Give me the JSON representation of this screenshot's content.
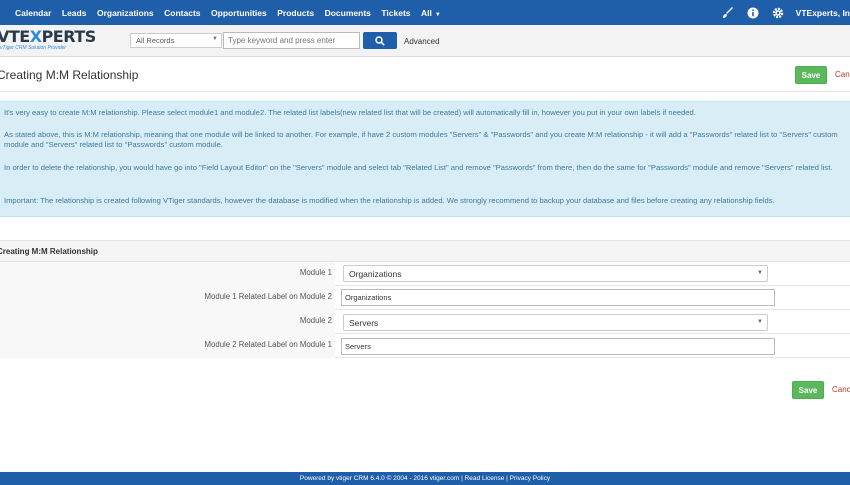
{
  "nav": {
    "items": [
      "Calendar",
      "Leads",
      "Organizations",
      "Contacts",
      "Opportunities",
      "Products",
      "Documents",
      "Tickets",
      "All"
    ],
    "user": "VTExperts, In"
  },
  "search": {
    "records_select": "All Records",
    "keyword_placeholder": "Type keyword and press enter",
    "advanced_label": "Advanced"
  },
  "logo": {
    "brand_a": "VTE",
    "brand_b": "X",
    "brand_c": "PERTS",
    "tagline": "vTiger CRM Solution Provider"
  },
  "page": {
    "title": "Creating M:M Relationship",
    "save_label": "Save",
    "cancel_label": "Cancel"
  },
  "info": {
    "p1": "It's very easy to create M:M relationship. Please select module1 and module2. The related list labels(new related list that will be created) will automatically fill in, however you put in your own labels if needed.",
    "p2": "As stated above, this is M:M relationship, meaning that one module will be linked to another. For example, if have 2 custom modules \"Servers\" & \"Passwords\" and you create M:M relationship - it will add a \"Passwords\" related list to \"Servers\" custom module and \"Servers\" related list to \"Passwords\" custom module.",
    "p3": "In order to delete the relationship, you would have go into \"Field Layout Editor\" on the \"Servers\" module and select tab \"Related List\" and remove \"Passwords\" from there, then do the same for \"Passwords\" module and remove \"Servers\" related list.",
    "p4": "Important: The relationship is created following VTiger standards, however the database is modified when the relationship is added. We strongly recommend to backup your database and files before creating any relationship fields."
  },
  "form": {
    "section_title": "Creating M:M Relationship",
    "module1_label": "Module 1",
    "module1_value": "Organizations",
    "module1_related_label": "Module 1 Related Label on Module 2",
    "module1_related_value": "Organizations",
    "module2_label": "Module 2",
    "module2_value": "Servers",
    "module2_related_label": "Module 2 Related Label on Module 1",
    "module2_related_value": "Servers"
  },
  "footer": {
    "text": "Powered by vtiger CRM 6.4.0  © 2004 - 2016  vtiger.com | Read License | Privacy Policy"
  },
  "colors": {
    "nav_bg": "#1f5ea8",
    "save_green": "#5cb85c",
    "info_bg": "#d9edf7",
    "cancel_red": "#c0392b"
  },
  "icons": {
    "search": "search-icon",
    "brush": "brush-icon",
    "info": "info-icon",
    "gear": "gear-icon"
  }
}
